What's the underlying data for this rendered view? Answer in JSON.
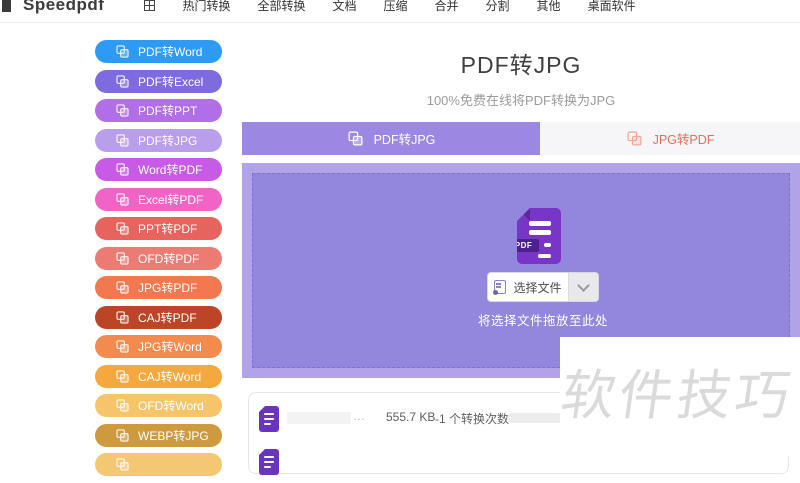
{
  "colors": {
    "accent_purple": "#9C87E2",
    "dropzone_outer": "#B2A3E9",
    "dropzone_inner": "#9386DD",
    "inactive_tab_text": "#E4705C",
    "pdf_icon_purple": "#7936C6",
    "watermark_gray": "#DADADA"
  },
  "header": {
    "logo": "Speedpdf",
    "nav_items": [
      {
        "label": "热门转换"
      },
      {
        "label": "全部转换"
      },
      {
        "label": "文档"
      },
      {
        "label": "压缩"
      },
      {
        "label": "合并"
      },
      {
        "label": "分割"
      },
      {
        "label": "其他"
      },
      {
        "label": "桌面软件"
      }
    ]
  },
  "sidebar": {
    "items": [
      {
        "label": "PDF转Word",
        "color": "#2D9BF4"
      },
      {
        "label": "PDF转Excel",
        "color": "#7D6BDF"
      },
      {
        "label": "PDF转PPT",
        "color": "#B06FE6"
      },
      {
        "label": "PDF转JPG",
        "color": "#B99EEB"
      },
      {
        "label": "Word转PDF",
        "color": "#C75BE6"
      },
      {
        "label": "Excel转PDF",
        "color": "#F164C5"
      },
      {
        "label": "PPT转PDF",
        "color": "#E6635E"
      },
      {
        "label": "OFD转PDF",
        "color": "#EC7B73"
      },
      {
        "label": "JPG转PDF",
        "color": "#F3774F"
      },
      {
        "label": "CAJ转PDF",
        "color": "#BC4527"
      },
      {
        "label": "JPG转Word",
        "color": "#F48B4D"
      },
      {
        "label": "CAJ转Word",
        "color": "#F4A83E"
      },
      {
        "label": "OFD转Word",
        "color": "#F6C569"
      },
      {
        "label": "WEBP转JPG",
        "color": "#CE9A3E"
      },
      {
        "label": "",
        "color": "#F4C773"
      }
    ]
  },
  "main": {
    "title": "PDF转JPG",
    "subtitle": "100%免费在线将PDF转换为JPG",
    "tabs": [
      {
        "label": "PDF转JPG",
        "active": true
      },
      {
        "label": "JPG转PDF",
        "active": false
      }
    ],
    "dropzone": {
      "file_badge": "PDF",
      "select_button_label": "选择文件",
      "hint": "将选择文件拖放至此处"
    },
    "file_list": {
      "row": {
        "redacted_name_tail": "…",
        "size": "555.7 KB",
        "count": "-1 个转换次数"
      }
    }
  },
  "watermark": "软件技巧"
}
